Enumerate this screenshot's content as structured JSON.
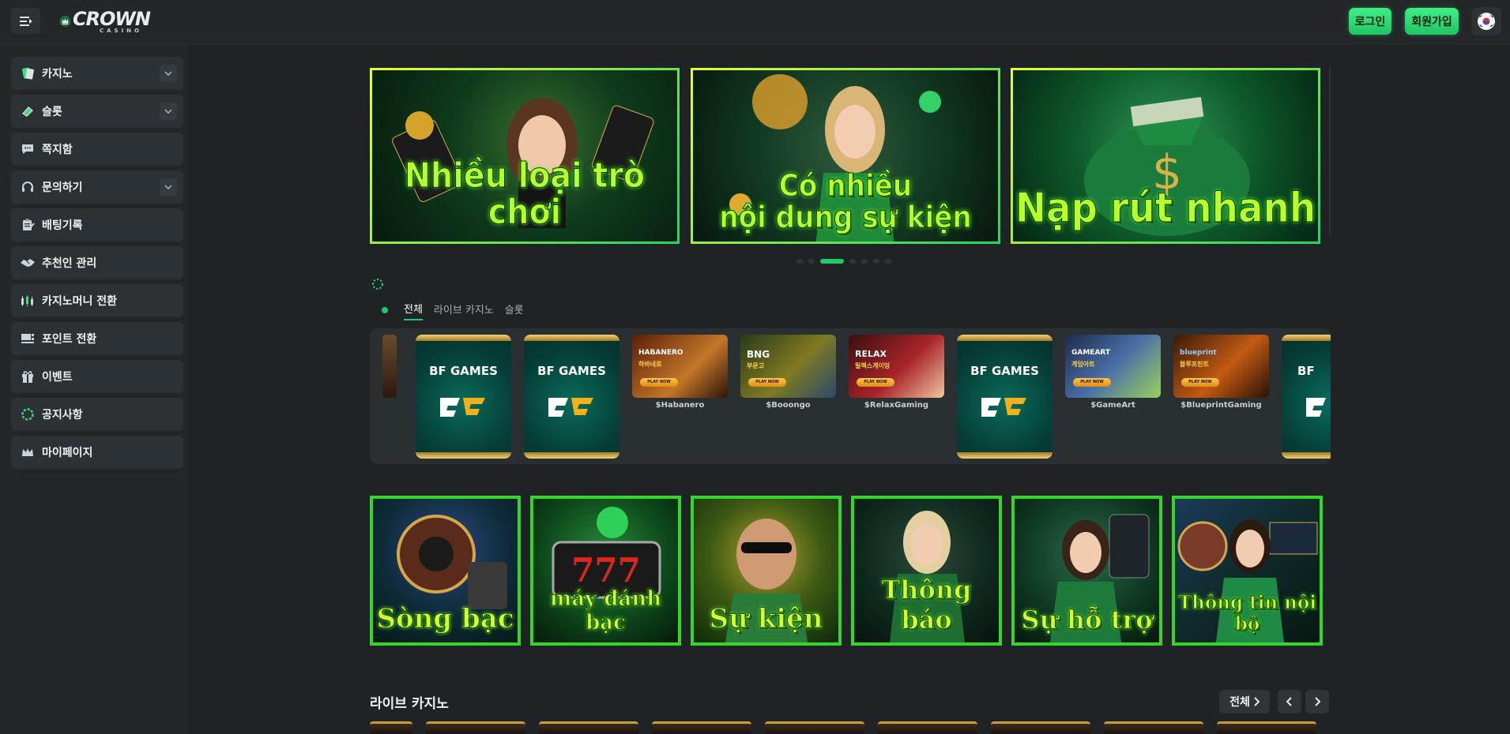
{
  "header": {
    "logo_text": "CROWN",
    "logo_sub": "CASINO",
    "login_label": "로그인",
    "signup_label": "회원가입"
  },
  "sidebar": {
    "items": [
      {
        "label": "카지노",
        "icon": "cards-icon",
        "has_dropdown": true
      },
      {
        "label": "슬롯",
        "icon": "slot-ticket-icon",
        "has_dropdown": true
      },
      {
        "label": "쪽지함",
        "icon": "message-icon",
        "has_dropdown": false
      },
      {
        "label": "문의하기",
        "icon": "headset-icon",
        "has_dropdown": true
      },
      {
        "label": "배팅기록",
        "icon": "clipboard-icon",
        "has_dropdown": false
      },
      {
        "label": "추천인 관리",
        "icon": "handshake-icon",
        "has_dropdown": false
      },
      {
        "label": "카지노머니 전환",
        "icon": "exchange-icon",
        "has_dropdown": false
      },
      {
        "label": "포인트 전환",
        "icon": "points-icon",
        "has_dropdown": false
      },
      {
        "label": "이벤트",
        "icon": "gift-icon",
        "has_dropdown": false
      },
      {
        "label": "공지사항",
        "icon": "notice-icon",
        "has_dropdown": false
      },
      {
        "label": "마이페이지",
        "icon": "crown-icon",
        "has_dropdown": false
      }
    ]
  },
  "banners": [
    {
      "text": "Nhiều loại trò chơi"
    },
    {
      "text_line1": "Có nhiều",
      "text_line2": "nội dung sự kiện"
    },
    {
      "text": "Nạp rút nhanh"
    }
  ],
  "carousel": {
    "total": 7,
    "active_index": 2
  },
  "game_tabs": [
    "전체",
    "라이브 카지노",
    "슬롯"
  ],
  "game_tabs_active": 0,
  "games": [
    {
      "type": "bf",
      "title": "BF GAMES"
    },
    {
      "type": "bf",
      "title": "BF GAMES"
    },
    {
      "type": "provider",
      "brand": "HABANERO",
      "sub": "하바네로",
      "label": "$Habanero"
    },
    {
      "type": "provider",
      "brand": "BNG",
      "sub": "부운고",
      "label": "$Booongo"
    },
    {
      "type": "provider",
      "brand": "RELAX",
      "sub": "릴렉스게이밍",
      "label": "$RelaxGaming"
    },
    {
      "type": "bf",
      "title": "BF GAMES"
    },
    {
      "type": "provider",
      "brand": "GAMEART",
      "sub": "게임아트",
      "label": "$GameArt"
    },
    {
      "type": "provider",
      "brand": "blueprint",
      "sub": "블루프린트",
      "label": "$BlueprintGaming"
    },
    {
      "type": "bf",
      "title": "BF"
    }
  ],
  "play_now": "PLAY NOW",
  "categories": [
    {
      "text": "Sòng bạc"
    },
    {
      "text": "máy đánh bạc"
    },
    {
      "text": "Sự kiện"
    },
    {
      "text": "Thông báo"
    },
    {
      "text": "Sự hỗ trợ"
    },
    {
      "text": "Thông tin nội bộ"
    }
  ],
  "live_section": {
    "title": "라이브 카지노",
    "all_label": "전체"
  }
}
